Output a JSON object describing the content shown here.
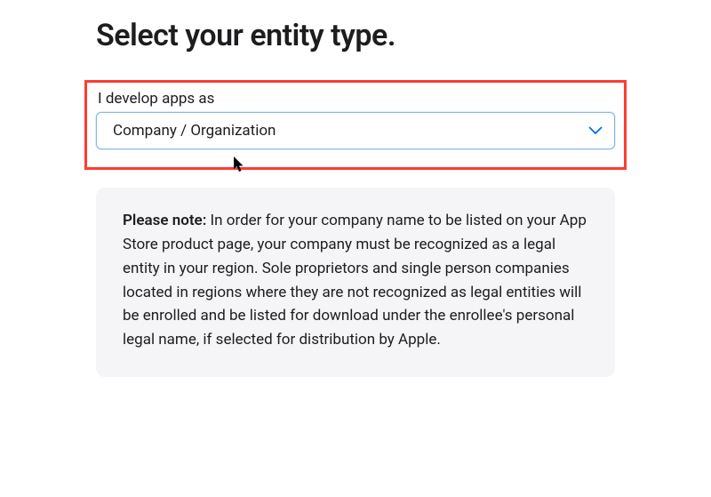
{
  "page": {
    "title": "Select your entity type."
  },
  "form": {
    "label": "I develop apps as",
    "selected": "Company / Organization"
  },
  "note": {
    "prefix": "Please note:",
    "body": " In order for your company name to be listed on your App Store product page, your company must be recognized as a legal entity in your region. Sole proprietors and single person companies located in regions where they are not recognized as legal entities will be enrolled and be listed for download under the enrollee's personal legal name, if selected for distribution by Apple."
  },
  "colors": {
    "highlight": "#ff3b30",
    "select_border": "#86b7e8",
    "chevron": "#0066cc",
    "note_bg": "#f5f5f7"
  }
}
